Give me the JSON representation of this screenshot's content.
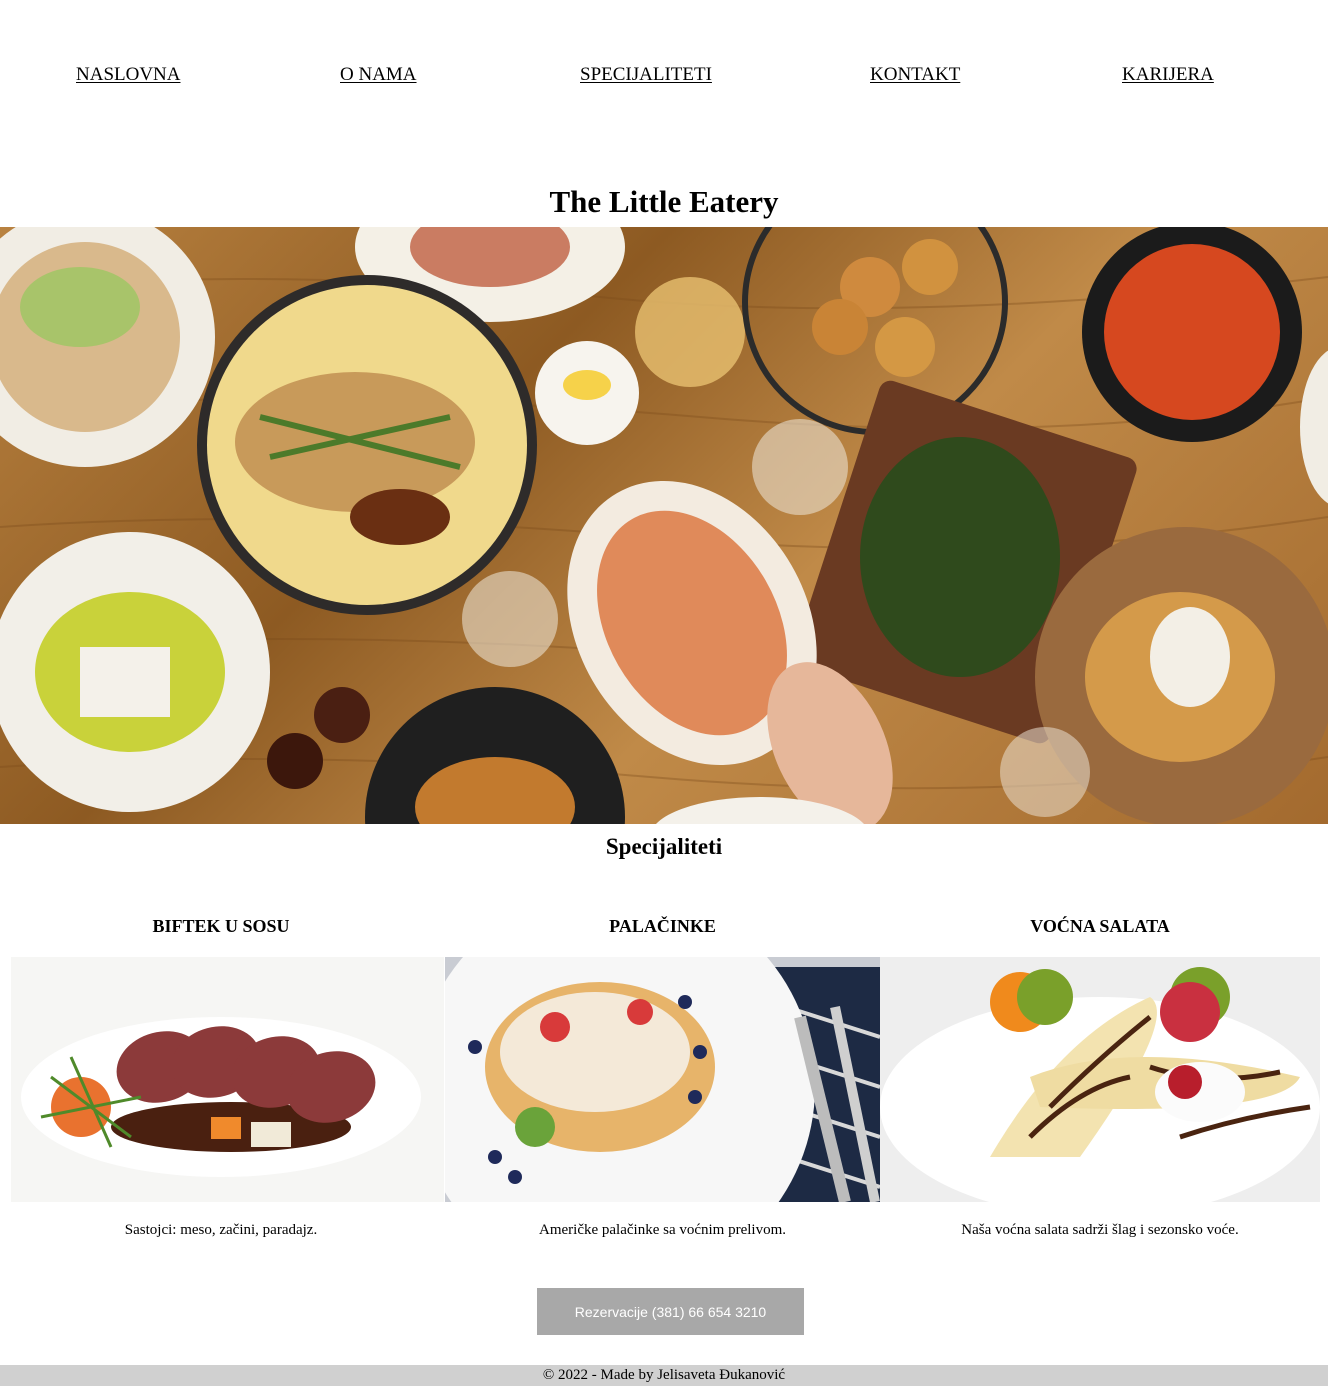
{
  "nav": {
    "items": [
      "NASLOVNA",
      "O NAMA",
      "SPECIJALITETI",
      "KONTAKT",
      "KARIJERA"
    ]
  },
  "site_title": "The Little Eatery",
  "specials": {
    "heading": "Specijaliteti",
    "items": [
      {
        "title": "BIFTEK U SOSU",
        "description": "Sastojci: meso, začini, paradajz."
      },
      {
        "title": "PALAČINKE",
        "description": "Američke palačinke sa voćnim prelivom."
      },
      {
        "title": "VOĆNA SALATA",
        "description": "Naša voćna salata sadrži šlag i sezonsko voće."
      }
    ]
  },
  "reserve_button": "Rezervacije (381) 66 654 3210",
  "footer": "© 2022 - Made by Jelisaveta Đukanović",
  "colors": {
    "button_bg": "#a8a8a8",
    "footer_bg": "#d0d0d0",
    "table_wood": "#a86e32"
  }
}
